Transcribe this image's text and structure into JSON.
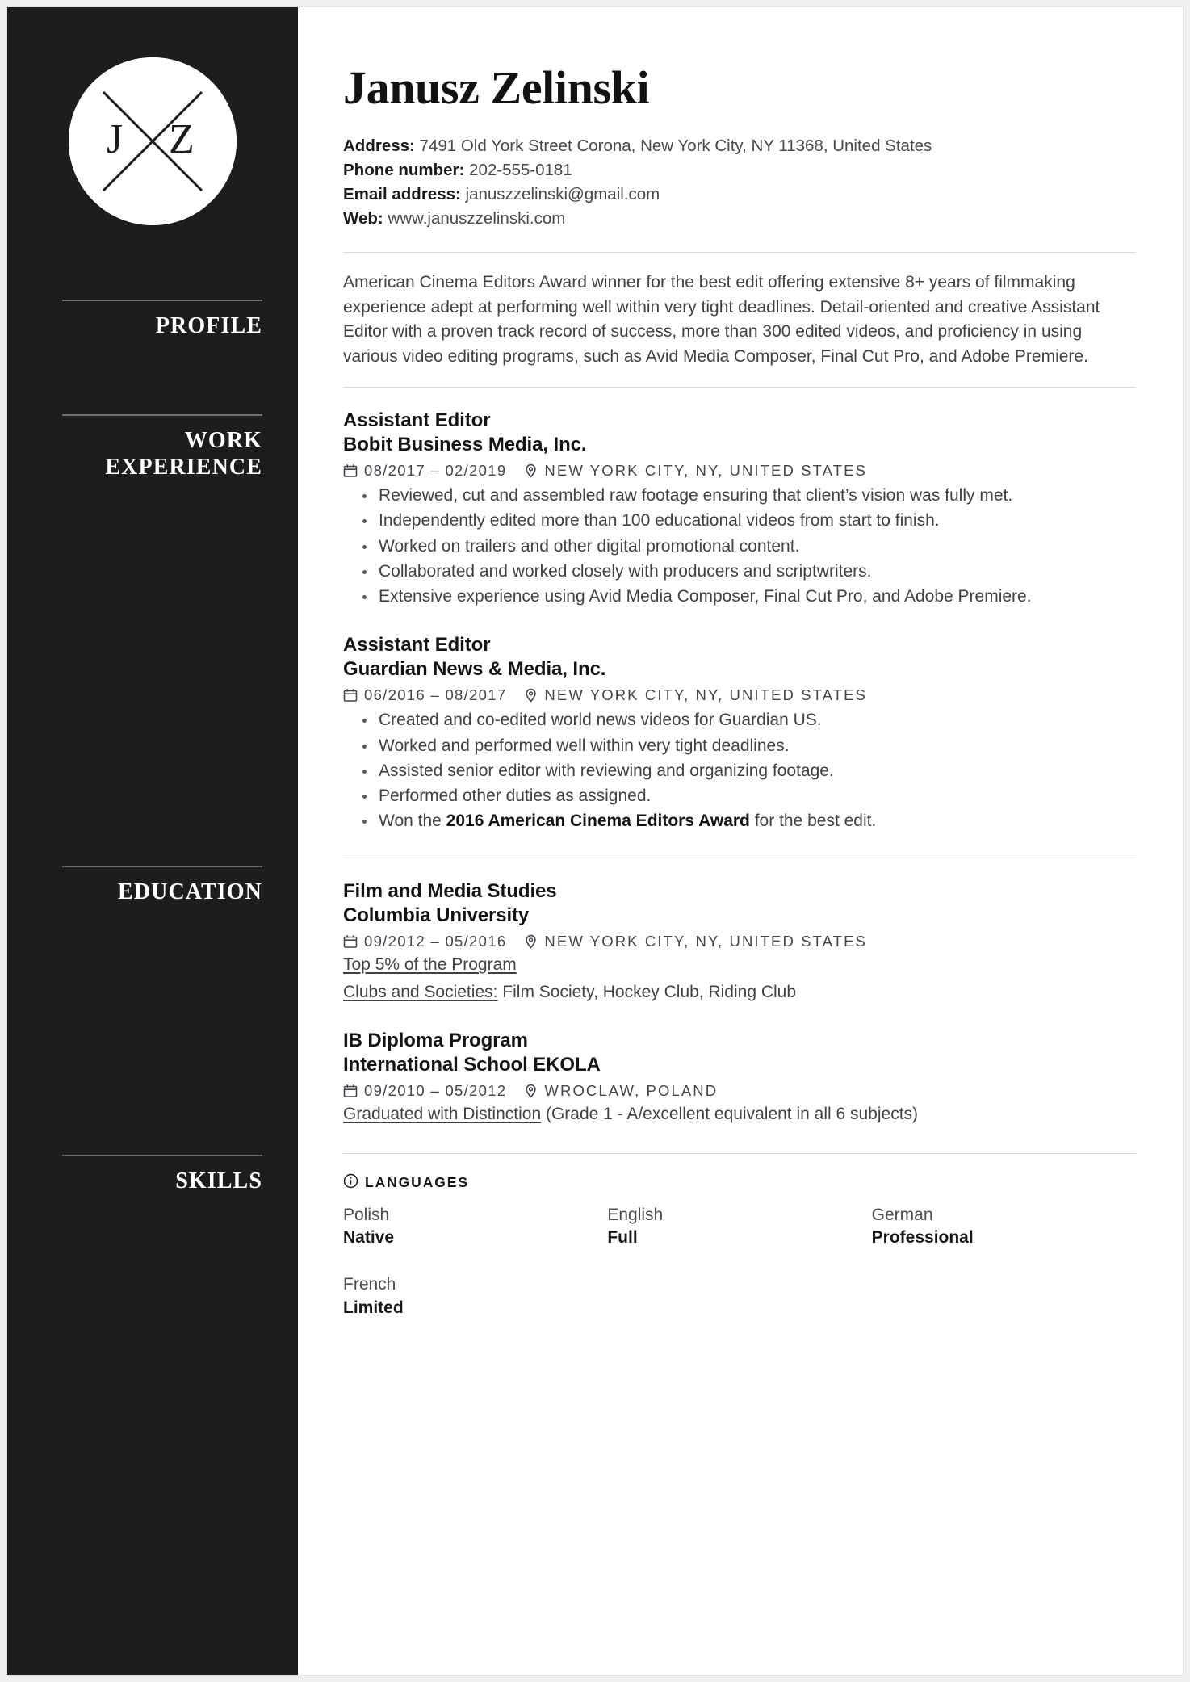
{
  "document": {
    "type": "resume",
    "accent_dark": "#1d1d1d",
    "page_background": "#ffffff"
  },
  "sidebar": {
    "logo": {
      "initial_left": "J",
      "initial_right": "Z",
      "shape": "circle-with-x"
    },
    "sections": [
      {
        "label": "PROFILE"
      },
      {
        "label": "WORK\nEXPERIENCE",
        "line1": "WORK",
        "line2": "EXPERIENCE"
      },
      {
        "label": "EDUCATION"
      },
      {
        "label": "SKILLS"
      }
    ]
  },
  "header": {
    "name": "Janusz Zelinski",
    "contacts": [
      {
        "key": "Address:",
        "value": "7491 Old York Street Corona, New York City, NY 11368, United States"
      },
      {
        "key": "Phone number:",
        "value": "202-555-0181"
      },
      {
        "key": "Email address:",
        "value": "januszzelinski@gmail.com"
      },
      {
        "key": "Web:",
        "value": "www.januszzelinski.com"
      }
    ]
  },
  "profile": {
    "text": "American Cinema Editors Award winner for the best edit offering extensive 8+ years of filmmaking experience adept at performing well within very tight deadlines. Detail-oriented and creative Assistant Editor with a proven track record of success, more than 300 edited videos, and proficiency in using various video editing programs, such as Avid Media Composer, Final Cut Pro, and Adobe Premiere."
  },
  "work_experience": [
    {
      "title": "Assistant Editor",
      "organization": "Bobit Business Media, Inc.",
      "date": "08/2017 – 02/2019",
      "location": "NEW YORK CITY, NY, UNITED STATES",
      "bullets": [
        {
          "text": "Reviewed, cut and assembled raw footage ensuring that client’s vision was fully met."
        },
        {
          "text": "Independently edited more than 100 educational videos from start to finish."
        },
        {
          "text": "Worked on trailers and other digital promotional content."
        },
        {
          "text": "Collaborated and worked closely with producers and scriptwriters."
        },
        {
          "text": "Extensive experience using Avid Media Composer, Final Cut Pro, and Adobe Premiere."
        }
      ]
    },
    {
      "title": "Assistant Editor",
      "organization": "Guardian News & Media, Inc.",
      "date": "06/2016 – 08/2017",
      "location": "NEW YORK CITY, NY, UNITED STATES",
      "bullets": [
        {
          "text": "Created and co-edited world news videos for Guardian US."
        },
        {
          "text": "Worked and performed well within very tight deadlines."
        },
        {
          "text": "Assisted senior editor with reviewing and organizing footage."
        },
        {
          "text": "Performed other duties as assigned."
        },
        {
          "pre": "Won the ",
          "bold": "2016 American Cinema Editors Award",
          "post": " for the best edit."
        }
      ]
    }
  ],
  "education": [
    {
      "title": "Film and Media Studies",
      "organization": "Columbia University",
      "date": "09/2012 – 05/2016",
      "location": "NEW YORK CITY, NY, UNITED STATES",
      "notes": [
        {
          "underlined": "Top 5% of the Program",
          "rest": ""
        },
        {
          "underlined": "Clubs and Societies:",
          "rest": " Film Society, Hockey Club, Riding Club"
        }
      ]
    },
    {
      "title": "IB Diploma Program",
      "organization": "International School EKOLA",
      "date": "09/2010 – 05/2012",
      "location": "WROCLAW, POLAND",
      "notes": [
        {
          "underlined": "Graduated with Distinction",
          "rest": " (Grade 1 - A/excellent equivalent in all 6 subjects)"
        }
      ]
    }
  ],
  "skills": {
    "group_label": "LANGUAGES",
    "languages": [
      {
        "name": "Polish",
        "level": "Native"
      },
      {
        "name": "English",
        "level": "Full"
      },
      {
        "name": "German",
        "level": "Professional"
      },
      {
        "name": "French",
        "level": "Limited"
      }
    ]
  },
  "icons": {
    "calendar": "calendar-icon",
    "location": "location-pin-icon",
    "info": "info-icon"
  }
}
